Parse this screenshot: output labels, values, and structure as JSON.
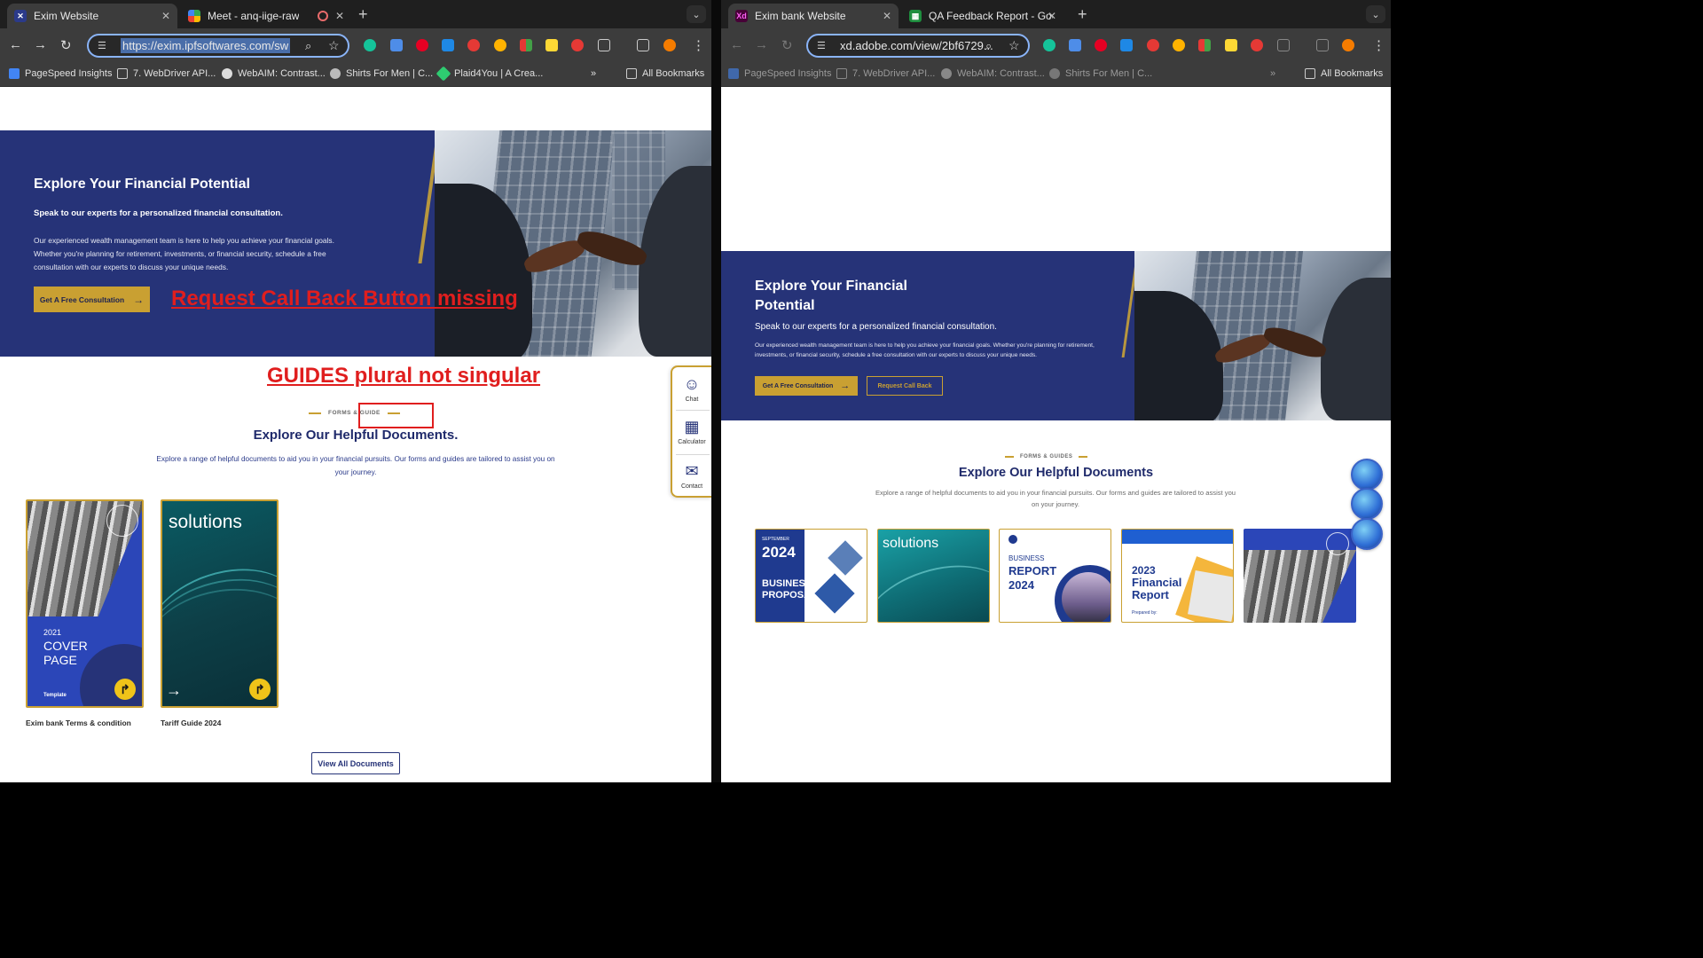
{
  "left": {
    "tabs": [
      {
        "title": "Exim Website",
        "active": true
      },
      {
        "title": "Meet - anq-iige-raw",
        "active": false
      }
    ],
    "address": "https://exim.ipfsoftwares.com/sw",
    "bookmarks": [
      "PageSpeed Insights",
      "7. WebDriver API...",
      "WebAIM: Contrast...",
      "Shirts For Men | C...",
      "Plaid4You | A Crea..."
    ],
    "all_bookmarks": "All Bookmarks",
    "hero": {
      "title": "Explore Your Financial Potential",
      "subtitle": "Speak to our experts for a personalized financial consultation.",
      "body": "Our experienced wealth management team is here to help you achieve your financial goals. Whether you're planning for retirement, investments, or financial security, schedule a free consultation with our experts to discuss your unique needs.",
      "cta": "Get A Free Consultation"
    },
    "annotations": {
      "missing_button": "Request Call Back Button missing",
      "guides_plural": "GUIDES plural not singular"
    },
    "docs": {
      "eyebrow": "FORMS & GUIDE",
      "title": "Explore Our Helpful Documents.",
      "body": "Explore a range of helpful documents to aid you in your financial pursuits. Our forms and guides are tailored to assist you on your journey.",
      "cards": [
        {
          "year": "2021",
          "line1": "COVER",
          "line2": "PAGE",
          "label": "Exim bank Terms & condition",
          "brand": "Template"
        },
        {
          "heading": "solutions",
          "label": "Tariff Guide 2024"
        }
      ],
      "view_all": "View All Documents"
    },
    "side_widget": [
      "Chat",
      "Calculator",
      "Contact"
    ]
  },
  "right": {
    "tabs": [
      {
        "title": "Exim bank Website",
        "active": true
      },
      {
        "title": "QA Feedback Report - Googl",
        "active": false
      }
    ],
    "address": "xd.adobe.com/view/2bf6729...",
    "bookmarks": [
      "PageSpeed Insights",
      "7. WebDriver API...",
      "WebAIM: Contrast...",
      "Shirts For Men | C..."
    ],
    "all_bookmarks": "All Bookmarks",
    "hero": {
      "title_line1": "Explore Your Financial",
      "title_line2": "Potential",
      "subtitle": "Speak to our experts for a personalized financial consultation.",
      "body": "Our experienced wealth management team is here to help you achieve your financial goals. Whether you're planning for retirement, investments, or financial security, schedule a free consultation with our experts to discuss your unique needs.",
      "cta": "Get A Free Consultation",
      "cta2": "Request Call Back"
    },
    "docs": {
      "eyebrow": "FORMS & GUIDES",
      "title": "Explore Our Helpful Documents",
      "body": "Explore a range of helpful documents to aid you in your financial pursuits. Our forms and guides are tailored to assist you on your journey.",
      "cards": [
        {
          "line1": "SEPTEMBER",
          "year": "2024",
          "t1": "BUSINESS",
          "t2": "PROPOSAL"
        },
        {
          "heading": "solutions"
        },
        {
          "t1": "BUSINESS",
          "t2": "REPORT",
          "year": "2024"
        },
        {
          "year": "2023",
          "t1": "Financial",
          "t2": "Report",
          "t3": "Prepared by:"
        },
        {}
      ]
    }
  }
}
